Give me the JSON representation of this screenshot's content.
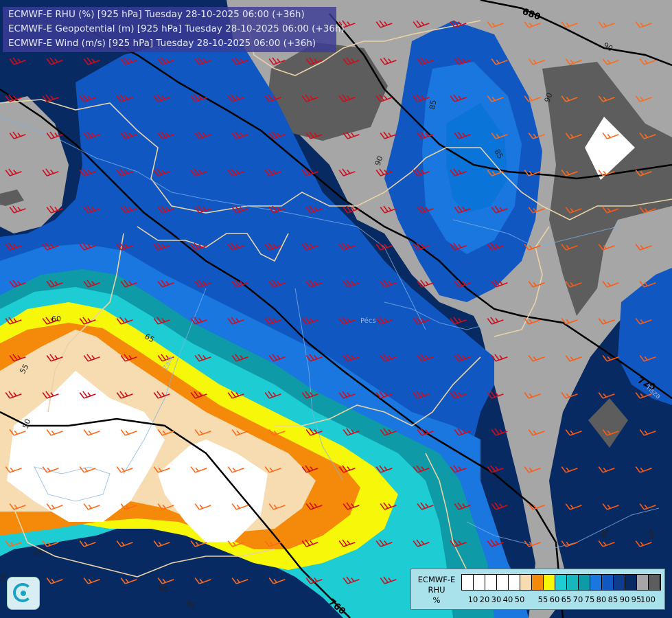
{
  "header": {
    "line1": "ECMWF-E RHU (%) [925 hPa] Tuesday 28-10-2025 06:00 (+36h)",
    "line2": "ECMWF-E Geopotential (m) [925 hPa] Tuesday 28-10-2025 06:00 (+36h)",
    "line3": "ECMWF-E Wind (m/s) [925 hPa] Tuesday 28-10-2025 06:00 (+36h)"
  },
  "legend": {
    "title_line1": "ECMWF-E",
    "title_line2": "RHU",
    "unit": "%",
    "colors": [
      "#ffffff",
      "#ffffff",
      "#ffffff",
      "#ffffff",
      "#ffffff",
      "#f6dcb0",
      "#f58a0a",
      "#f7f70a",
      "#1ecdd3",
      "#17b8bd",
      "#0e9aa6",
      "#1a77e0",
      "#1057c2",
      "#0d3d8c",
      "#082a63",
      "#a6a6a6",
      "#5d5d5d"
    ],
    "tick_labels": [
      "10",
      "20",
      "30",
      "40",
      "50",
      "55",
      "60",
      "65",
      "70",
      "75",
      "80",
      "85",
      "90",
      "95",
      "100"
    ]
  },
  "geopotential_labels": [
    "680",
    "720",
    "760"
  ],
  "rhu_contour_labels": [
    "60",
    "65",
    "55",
    "50",
    "65",
    "70",
    "80",
    "85",
    "90",
    "90",
    "90",
    "85",
    "75",
    "85",
    "80"
  ],
  "places": [
    "Pécs",
    "Tisza",
    "Zala"
  ],
  "icon": "ecmwf-logo-icon"
}
